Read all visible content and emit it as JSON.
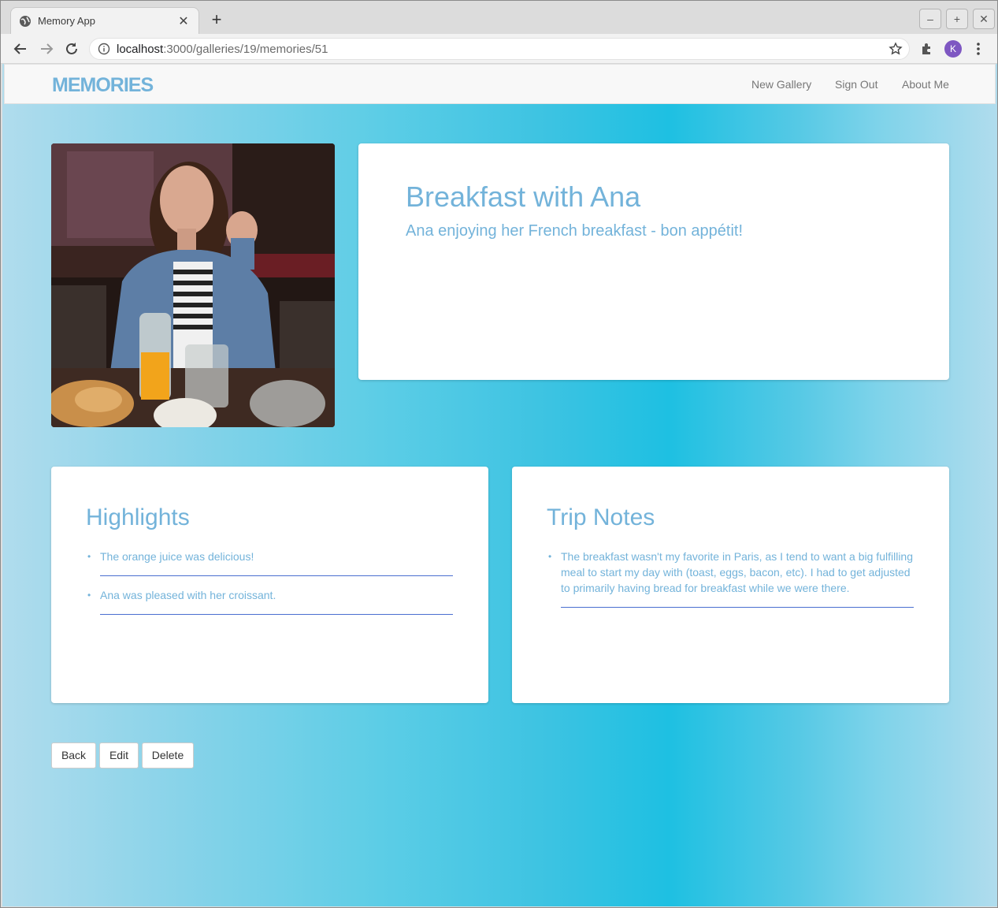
{
  "browser": {
    "tab_title": "Memory App",
    "url_host": "localhost",
    "url_path": ":3000/galleries/19/memories/51",
    "profile_initial": "K"
  },
  "navbar": {
    "brand": "MEMORIES",
    "links": [
      "New Gallery",
      "Sign Out",
      "About Me"
    ]
  },
  "memory": {
    "title": "Breakfast with Ana",
    "description": "Ana enjoying her French breakfast - bon appétit!",
    "photo_alt": "photo of Ana at breakfast table"
  },
  "highlights": {
    "heading": "Highlights",
    "items": [
      "The orange juice was delicious!",
      "Ana was pleased with her croissant."
    ]
  },
  "trip_notes": {
    "heading": "Trip Notes",
    "items": [
      "The breakfast wasn't my favorite in Paris, as I tend to want a big fulfilling meal to start my day with (toast, eggs, bacon, etc). I had to get adjusted to primarily having bread for breakfast while we were there."
    ]
  },
  "actions": {
    "back": "Back",
    "edit": "Edit",
    "delete": "Delete"
  },
  "colors": {
    "accent": "#73b3da",
    "divider": "#4a6fd0",
    "gradient_center": "#1ec0e2"
  }
}
